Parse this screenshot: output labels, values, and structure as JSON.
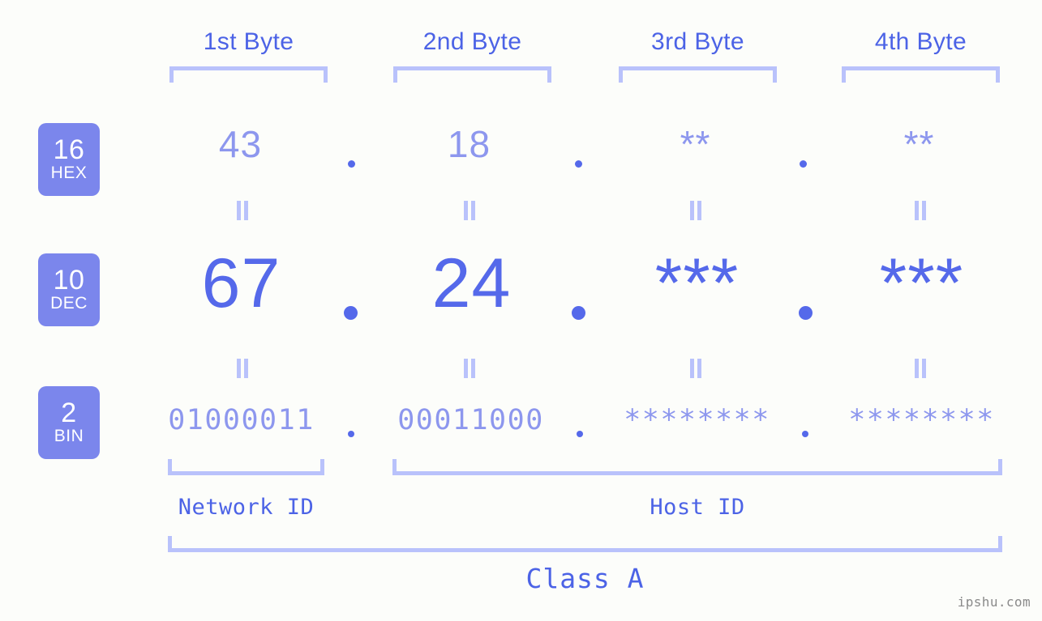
{
  "background_color": "#fcfdfa",
  "accent_strong": "#5569ea",
  "accent_light": "#8d97ee",
  "accent_bracket": "#b9c2fb",
  "badge_fill": "#7b86ec",
  "header": {
    "bytes": [
      {
        "label": "1st Byte"
      },
      {
        "label": "2nd Byte"
      },
      {
        "label": "3rd Byte"
      },
      {
        "label": "4th Byte"
      }
    ]
  },
  "radix_badges": [
    {
      "number": "16",
      "name": "HEX"
    },
    {
      "number": "10",
      "name": "DEC"
    },
    {
      "number": "2",
      "name": "BIN"
    }
  ],
  "rows": {
    "hex": {
      "radix": "16",
      "radix_name": "HEX",
      "values": [
        "43",
        "18",
        "**",
        "**"
      ],
      "separator": "."
    },
    "dec": {
      "radix": "10",
      "radix_name": "DEC",
      "values": [
        "67",
        "24",
        "***",
        "***"
      ],
      "separator": "."
    },
    "bin": {
      "radix": "2",
      "radix_name": "BIN",
      "values": [
        "01000011",
        "00011000",
        "********",
        "********"
      ],
      "separator": "."
    }
  },
  "connectors": {
    "symbol": "=",
    "count_per_gap": 4,
    "gaps": 2
  },
  "segments": {
    "network_id": "Network ID",
    "host_id": "Host ID",
    "class": "Class A"
  },
  "watermark": "ipshu.com"
}
